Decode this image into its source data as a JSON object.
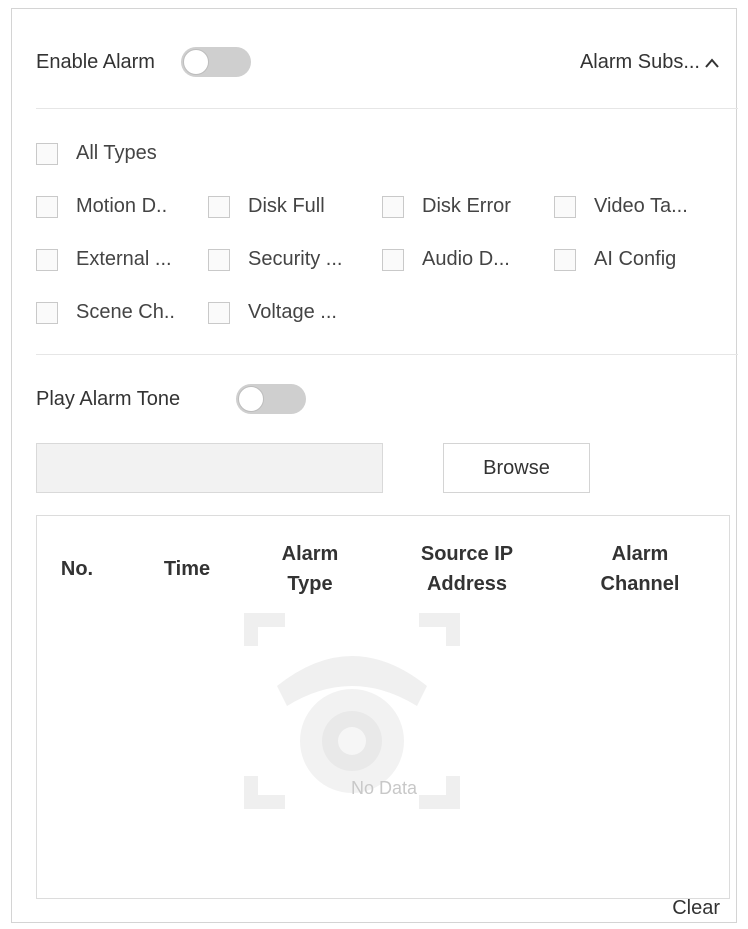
{
  "alarm": {
    "enable_label": "Enable Alarm",
    "enable_on": false,
    "subscription_label": "Alarm Subs...",
    "subscription_chevron": "^"
  },
  "types": {
    "all": "All Types",
    "items": [
      "Motion D..",
      "Disk Full",
      "Disk Error",
      "Video Ta...",
      "External ...",
      "Security ...",
      "Audio D...",
      "AI Config",
      "Scene Ch..",
      "Voltage ..."
    ]
  },
  "tone": {
    "label": "Play Alarm Tone",
    "on": false,
    "path_value": "",
    "browse_label": "Browse"
  },
  "table": {
    "headers": [
      "No.",
      "Time",
      "Alarm Type",
      "Source IP Address",
      "Alarm Channel"
    ],
    "empty_text": "No Data"
  },
  "clear_label": "Clear"
}
